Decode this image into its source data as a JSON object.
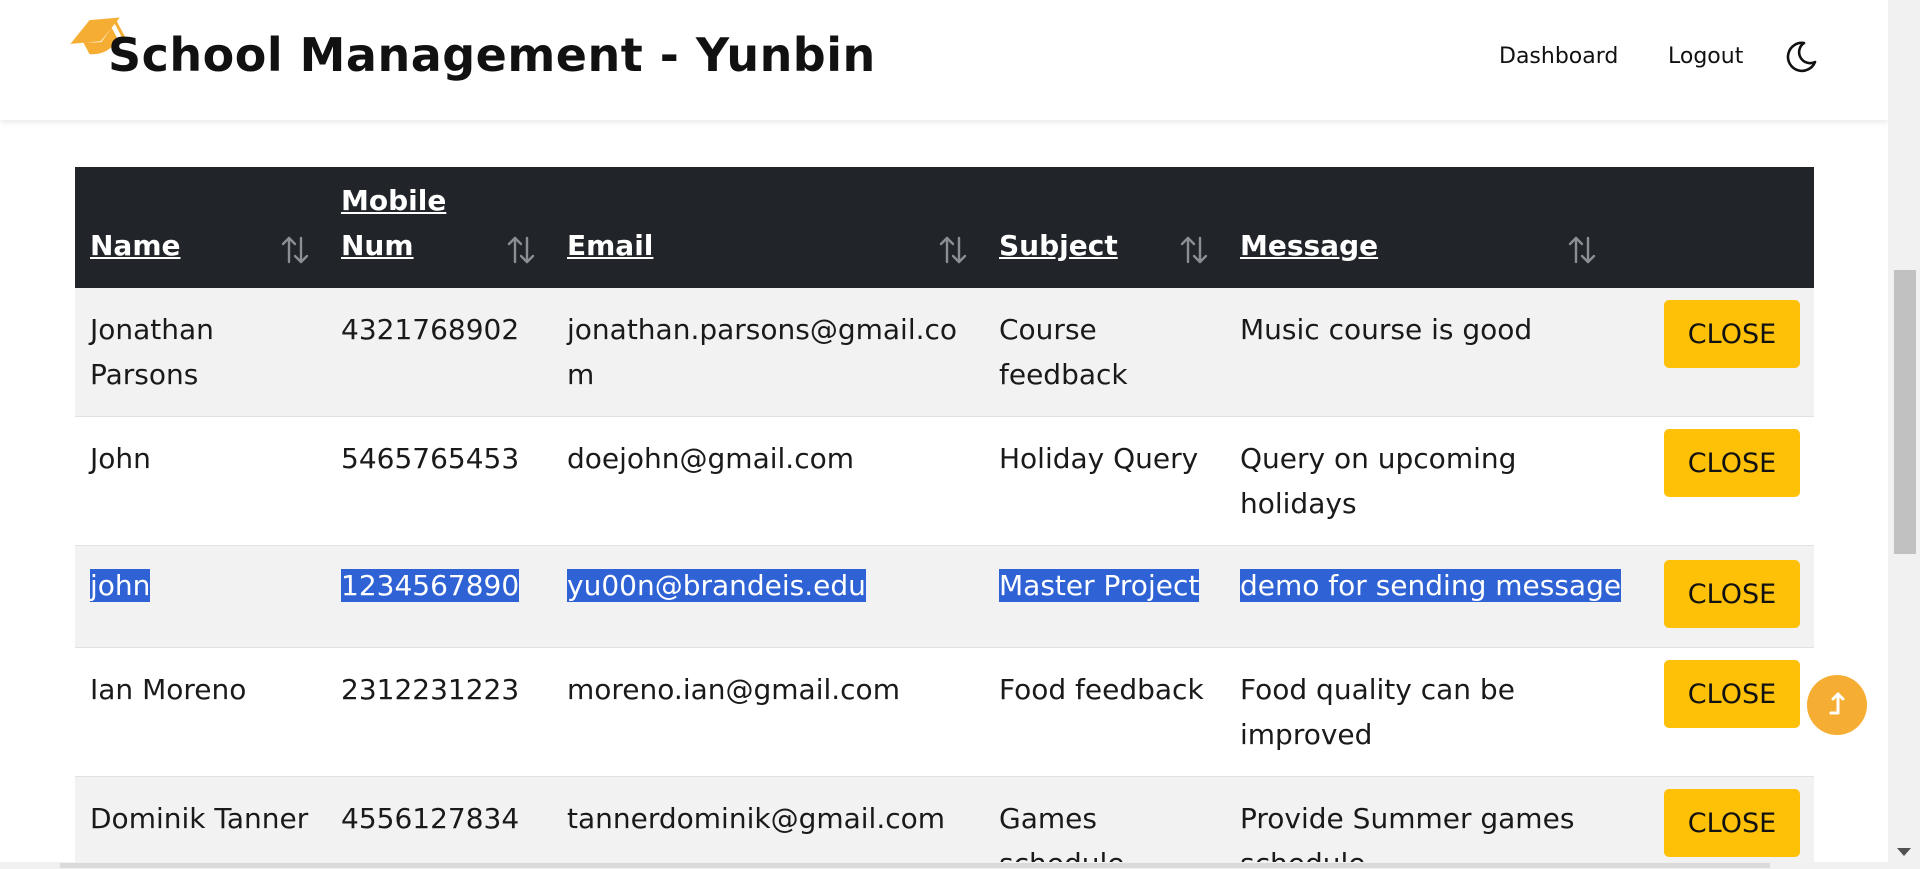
{
  "header": {
    "title": "School Management - Yunbin",
    "nav": {
      "dashboard": "Dashboard",
      "logout": "Logout"
    },
    "brand_icon": "graduation-cap-icon",
    "theme_icon": "moon-icon",
    "brand_color": "#f6ad33"
  },
  "table": {
    "columns": [
      "Name",
      "Mobile Num",
      "Email",
      "Subject",
      "Message"
    ],
    "header_lines": {
      "mobile_line1": "Mobile",
      "mobile_line2": "Num"
    },
    "close_label": "CLOSE",
    "rows": [
      {
        "name_line1": "Jonathan",
        "name_line2": "Parsons",
        "mobile": "4321768902",
        "email": "jonathan.parsons@gmail.com",
        "subject_line1": "Course",
        "subject_line2": "feedback",
        "message_line1": "Music course is good",
        "message_line2": ""
      },
      {
        "name_line1": "John",
        "name_line2": "",
        "mobile": "5465765453",
        "email": "doejohn@gmail.com",
        "subject_line1": "Holiday Query",
        "subject_line2": "",
        "message_line1": "Query on upcoming holidays",
        "message_line2": ""
      },
      {
        "name_line1": "john",
        "name_line2": "",
        "mobile": "1234567890",
        "email": "yu00n@brandeis.edu",
        "subject_line1": "Master Project",
        "subject_line2": "",
        "message_line1": "demo for sending message",
        "message_line2": ""
      },
      {
        "name_line1": "Ian Moreno",
        "name_line2": "",
        "mobile": "2312231223",
        "email": "moreno.ian@gmail.com",
        "subject_line1": "Food feedback",
        "subject_line2": "",
        "message_line1": "Food quality can be",
        "message_line2": "improved"
      },
      {
        "name_line1": "Dominik Tanner",
        "name_line2": "",
        "mobile": "4556127834",
        "email": "tannerdominik@gmail.com",
        "subject_line1": "Games",
        "subject_line2": "schedule",
        "message_line1": "Provide Summer games",
        "message_line2": "schedule"
      }
    ],
    "header_bg": "#212529",
    "button_color": "#ffc107",
    "selection_color": "#2f62d4"
  },
  "scroll_top_icon": "arrow-up-icon"
}
